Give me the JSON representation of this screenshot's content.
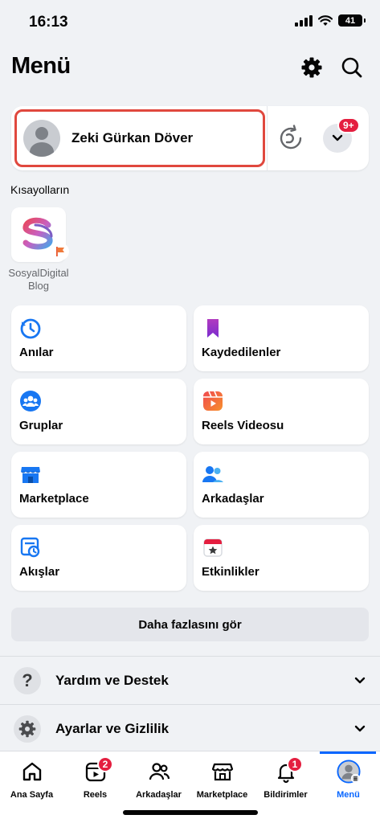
{
  "status_bar": {
    "time": "16:13",
    "battery": "41"
  },
  "header": {
    "title": "Menü",
    "settings_icon": "gear-icon",
    "search_icon": "search-icon"
  },
  "profile": {
    "name": "Zeki Gürkan Döver",
    "notification_count": "9+",
    "highlight_color": "#e0483e"
  },
  "shortcuts": {
    "label": "Kısayolların",
    "items": [
      {
        "name": "SosyalDigital Blog"
      }
    ]
  },
  "tiles": [
    {
      "label": "Anılar",
      "icon": "memories-clock-icon"
    },
    {
      "label": "Kaydedilenler",
      "icon": "bookmark-icon"
    },
    {
      "label": "Gruplar",
      "icon": "groups-icon"
    },
    {
      "label": "Reels Videosu",
      "icon": "reels-icon"
    },
    {
      "label": "Marketplace",
      "icon": "marketplace-store-icon"
    },
    {
      "label": "Arkadaşlar",
      "icon": "friends-icon"
    },
    {
      "label": "Akışlar",
      "icon": "feeds-icon"
    },
    {
      "label": "Etkinlikler",
      "icon": "events-calendar-icon"
    }
  ],
  "see_more": "Daha fazlasını gör",
  "sections": [
    {
      "label": "Yardım ve Destek",
      "icon": "help-icon"
    },
    {
      "label": "Ayarlar ve Gizlilik",
      "icon": "settings-gear-icon"
    }
  ],
  "tabbar": {
    "tabs": [
      {
        "label": "Ana Sayfa",
        "icon": "home-icon"
      },
      {
        "label": "Reels",
        "icon": "reels-play-icon",
        "badge": "2"
      },
      {
        "label": "Arkadaşlar",
        "icon": "friends-icon"
      },
      {
        "label": "Marketplace",
        "icon": "marketplace-icon"
      },
      {
        "label": "Bildirimler",
        "icon": "bell-icon",
        "badge": "1"
      },
      {
        "label": "Menü",
        "icon": "profile-menu-icon",
        "active": true
      }
    ]
  },
  "colors": {
    "accent": "#0866ff",
    "badge": "#e41e3f",
    "background": "#f0f2f5"
  }
}
